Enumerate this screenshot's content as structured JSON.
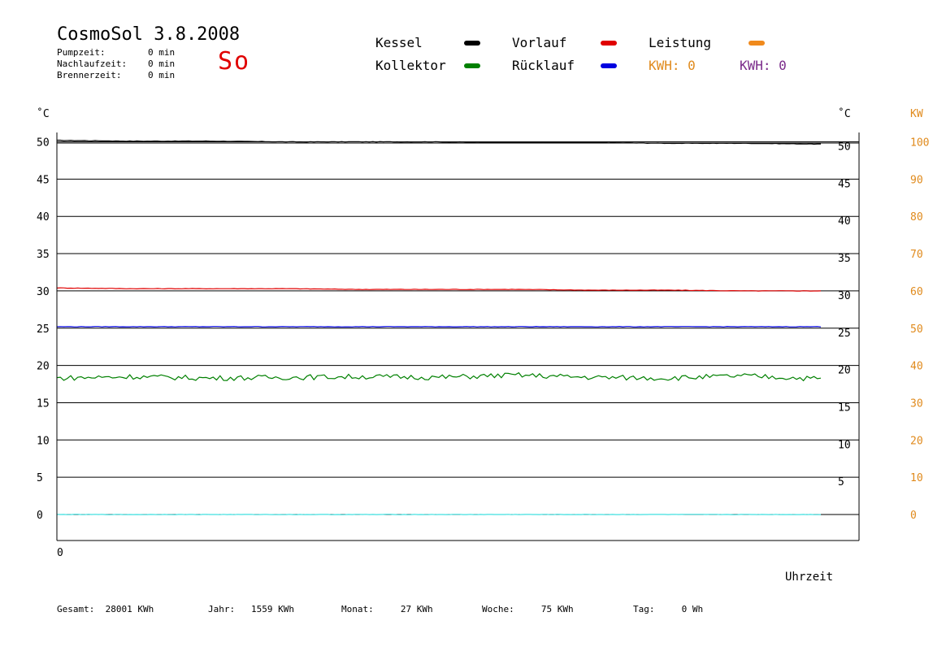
{
  "header": {
    "title": "CosmoSol 3.8.2008",
    "day": "So",
    "info": [
      {
        "label": "Pumpzeit:",
        "value": "0 min"
      },
      {
        "label": "Nachlaufzeit:",
        "value": "0 min"
      },
      {
        "label": "Brennerzeit:",
        "value": "0 min"
      }
    ]
  },
  "legend": {
    "kessel": {
      "label": "Kessel",
      "color": "#000000"
    },
    "vorlauf": {
      "label": "Vorlauf",
      "color": "#e00000"
    },
    "leistung": {
      "label": "Leistung",
      "color": "#f08a1c"
    },
    "kollektor": {
      "label": "Kollektor",
      "color": "#008000"
    },
    "ruecklauf": {
      "label": "Rücklauf",
      "color": "#0000e0"
    },
    "kwh1": "KWH: 0",
    "kwh2": "KWH: 0"
  },
  "footer": {
    "gesamt_label": "Gesamt:",
    "gesamt_value": "28001 KWh",
    "jahr_label": "Jahr:",
    "jahr_value": "1559 KWh",
    "monat_label": "Monat:",
    "monat_value": "27 KWh",
    "woche_label": "Woche:",
    "woche_value": "75 KWh",
    "tag_label": "Tag:",
    "tag_value": "0 Wh"
  },
  "chart_data": {
    "type": "line",
    "y_left_unit": "˚C",
    "y_right_unit": "˚C",
    "y_right2_unit": "KW",
    "xlabel": "Uhrzeit",
    "x_tick_labels": [
      "0"
    ],
    "ylim": [
      -3.5,
      51.5
    ],
    "y_ticks_left": [
      0,
      5,
      10,
      15,
      20,
      25,
      30,
      35,
      40,
      45,
      50
    ],
    "y_ticks_right": [
      5,
      10,
      15,
      20,
      25,
      30,
      35,
      40,
      45,
      50
    ],
    "y_ticks_kw": [
      0,
      10,
      20,
      30,
      40,
      50,
      60,
      70,
      80,
      90,
      100
    ],
    "x": [
      0,
      0.1,
      0.2,
      0.3,
      0.4,
      0.5,
      0.6,
      0.7,
      0.8,
      0.9,
      1
    ],
    "series": [
      {
        "name": "Kessel",
        "color": "#000000",
        "values": [
          50.2,
          50.1,
          50.1,
          50.0,
          50.0,
          50.0,
          49.9,
          49.9,
          49.8,
          49.8,
          49.7
        ]
      },
      {
        "name": "Vorlauf",
        "color": "#e00000",
        "values": [
          30.4,
          30.3,
          30.3,
          30.3,
          30.2,
          30.2,
          30.2,
          30.1,
          30.1,
          30.0,
          30.0
        ]
      },
      {
        "name": "Rücklauf",
        "color": "#0000e0",
        "values": [
          25.2,
          25.2,
          25.2,
          25.2,
          25.2,
          25.2,
          25.2,
          25.2,
          25.2,
          25.2,
          25.2
        ]
      },
      {
        "name": "Kollektor",
        "color": "#008000",
        "values": [
          18.3,
          18.5,
          18.3,
          18.4,
          18.5,
          18.4,
          18.7,
          18.4,
          18.3,
          18.6,
          18.2
        ]
      },
      {
        "name": "",
        "color": "#40e0e0",
        "values": [
          0,
          0,
          0,
          0,
          0,
          0,
          0,
          0,
          0,
          0,
          0
        ]
      }
    ],
    "grid": true
  }
}
